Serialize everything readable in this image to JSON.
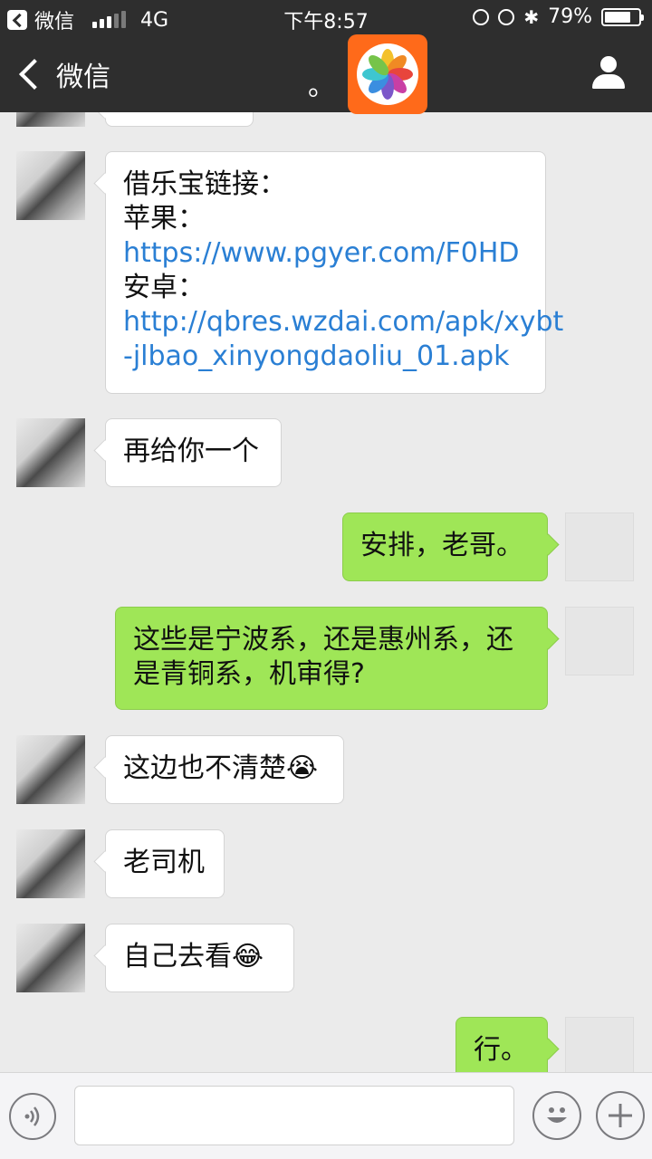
{
  "status_bar": {
    "carrier": "微信",
    "network": "4G",
    "time": "下午8:57",
    "battery_percent": "79%",
    "battery_level": 0.79
  },
  "nav": {
    "back_label": "微信",
    "title": "。"
  },
  "messages": [
    {
      "from": "other",
      "lines": [
        "借乐宝链接：",
        "苹果：",
        "https://www.pgyer.com/F0HD",
        "安卓：",
        "http://qbres.wzdai.com/apk/xybt",
        "-jlbao_xinyongdaoliu_01.apk"
      ]
    },
    {
      "from": "other",
      "text": "再给你一个"
    },
    {
      "from": "me",
      "text": "安排，老哥。"
    },
    {
      "from": "me",
      "lines": [
        "这些是宁波系，还是惠州系，还",
        "是青铜系，机审得?"
      ]
    },
    {
      "from": "other",
      "text": "这边也不清楚",
      "emoji": "😭"
    },
    {
      "from": "other",
      "text": "老司机"
    },
    {
      "from": "other",
      "text": "自己去看",
      "emoji": "😂"
    },
    {
      "from": "me",
      "text": "行。"
    }
  ],
  "colors": {
    "nav_bg": "#2e2e2e",
    "chat_bg": "#ebebeb",
    "bubble_me": "#9fe657",
    "link": "#2a7fd4",
    "app_icon_bg": "#ff6a1a"
  },
  "icons": {
    "voice": "voice-icon",
    "emoji": "emoji-icon",
    "plus": "plus-icon",
    "user": "user-icon"
  }
}
